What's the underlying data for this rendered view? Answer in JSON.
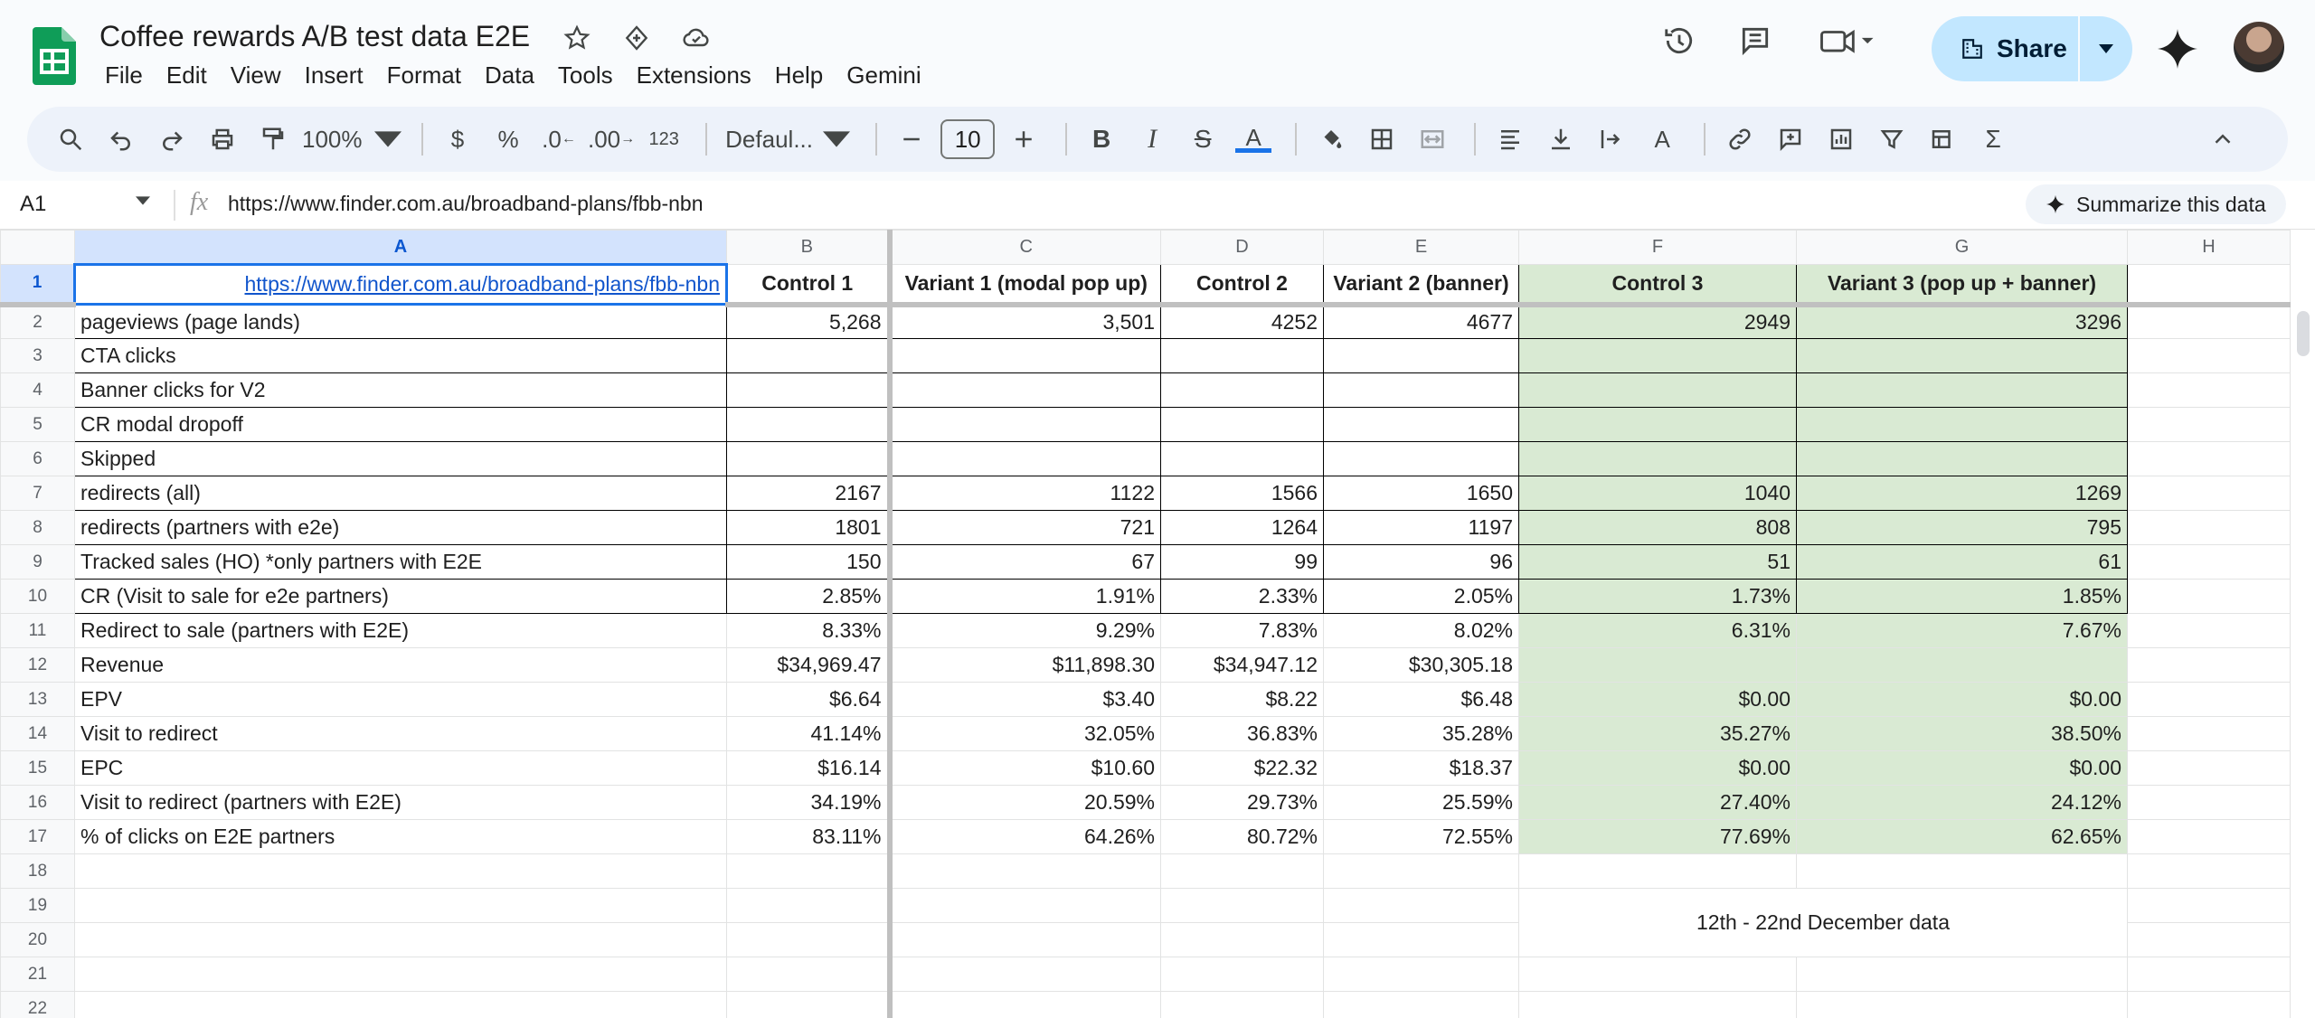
{
  "app": {
    "title": "Coffee rewards A/B test data E2E",
    "menu": [
      "File",
      "Edit",
      "View",
      "Insert",
      "Format",
      "Data",
      "Tools",
      "Extensions",
      "Help",
      "Gemini"
    ],
    "share_label": "Share",
    "accent": "#0b57d0",
    "share_bg": "#c2e7ff"
  },
  "toolbar": {
    "zoom": "100%",
    "currency": "$",
    "percent": "%",
    "decrease_decimal": ".0",
    "increase_decimal": ".00",
    "format_number": "123",
    "font": "Defaul...",
    "font_size": "10",
    "icons": [
      "search-icon",
      "undo-icon",
      "redo-icon",
      "print-icon",
      "paint-format-icon",
      "bold-icon",
      "italic-icon",
      "strikethrough-icon",
      "text-color-icon",
      "fill-color-icon",
      "borders-icon",
      "merge-icon",
      "align-icon",
      "valign-icon",
      "wrap-icon",
      "rotate-icon",
      "link-icon",
      "comment-icon",
      "chart-icon",
      "filter-icon",
      "filter-views-icon",
      "functions-icon",
      "collapse-icon"
    ]
  },
  "formula_bar": {
    "cell_ref": "A1",
    "fx": "fx",
    "value": "https://www.finder.com.au/broadband-plans/fbb-nbn",
    "summarize": "Summarize this data"
  },
  "sheet": {
    "columns": [
      "A",
      "B",
      "C",
      "D",
      "E",
      "F",
      "G",
      "H"
    ],
    "header_row": [
      "https://www.finder.com.au/broadband-plans/fbb-nbn",
      "Control 1",
      "Variant 1 (modal pop up)",
      "Control 2",
      "Variant 2 (banner)",
      "Control 3",
      "Variant 3 (pop up + banner)",
      ""
    ],
    "rows": [
      [
        "pageviews (page lands)",
        "5,268",
        "3,501",
        "4252",
        "4677",
        "2949",
        "3296"
      ],
      [
        "CTA clicks",
        "",
        "",
        "",
        "",
        "",
        ""
      ],
      [
        "Banner clicks for V2",
        "",
        "",
        "",
        "",
        "",
        ""
      ],
      [
        "CR modal dropoff",
        "",
        "",
        "",
        "",
        "",
        ""
      ],
      [
        "Skipped",
        "",
        "",
        "",
        "",
        "",
        ""
      ],
      [
        "redirects (all)",
        "2167",
        "1122",
        "1566",
        "1650",
        "1040",
        "1269"
      ],
      [
        "redirects (partners with e2e)",
        "1801",
        "721",
        "1264",
        "1197",
        "808",
        "795"
      ],
      [
        "Tracked sales (HO) *only partners with E2E",
        "150",
        "67",
        "99",
        "96",
        "51",
        "61"
      ],
      [
        "CR (Visit to sale for e2e partners)",
        "2.85%",
        "1.91%",
        "2.33%",
        "2.05%",
        "1.73%",
        "1.85%"
      ],
      [
        "Redirect to sale (partners with E2E)",
        "8.33%",
        "9.29%",
        "7.83%",
        "8.02%",
        "6.31%",
        "7.67%"
      ],
      [
        "Revenue",
        "$34,969.47",
        "$11,898.30",
        "$34,947.12",
        "$30,305.18",
        "",
        ""
      ],
      [
        "EPV",
        "$6.64",
        "$3.40",
        "$8.22",
        "$6.48",
        "$0.00",
        "$0.00"
      ],
      [
        "Visit to redirect",
        "41.14%",
        "32.05%",
        "36.83%",
        "35.28%",
        "35.27%",
        "38.50%"
      ],
      [
        "EPC",
        "$16.14",
        "$10.60",
        "$22.32",
        "$18.37",
        "$0.00",
        "$0.00"
      ],
      [
        "Visit to redirect (partners with E2E)",
        "34.19%",
        "20.59%",
        "29.73%",
        "25.59%",
        "27.40%",
        "24.12%"
      ],
      [
        "% of clicks on E2E partners",
        "83.11%",
        "64.26%",
        "80.72%",
        "72.55%",
        "77.69%",
        "62.65%"
      ]
    ],
    "row_numbers": [
      "1",
      "2",
      "3",
      "4",
      "5",
      "6",
      "7",
      "8",
      "9",
      "10",
      "11",
      "12",
      "13",
      "14",
      "15",
      "16",
      "17",
      "18",
      "19",
      "20",
      "21",
      "22"
    ],
    "note": "12th - 22nd December data",
    "green_fill": "#d9ead3"
  }
}
